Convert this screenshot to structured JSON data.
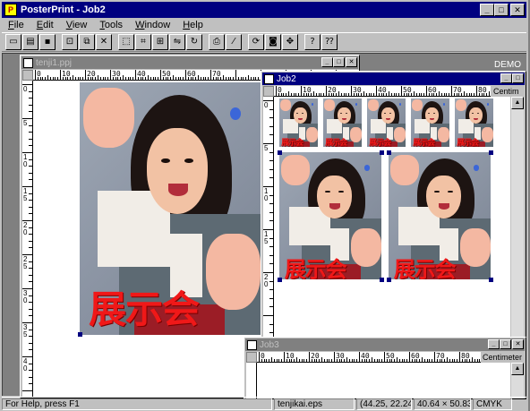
{
  "app": {
    "title": "PosterPrint - Job2",
    "icon_label": "P"
  },
  "menu": [
    "File",
    "Edit",
    "View",
    "Tools",
    "Window",
    "Help"
  ],
  "toolbar": {
    "buttons": [
      {
        "name": "new-icon",
        "glyph": "▭"
      },
      {
        "name": "open-icon",
        "glyph": "▤"
      },
      {
        "name": "save-icon",
        "glyph": "▪"
      },
      {
        "name": "import-icon",
        "glyph": "⊡"
      },
      {
        "name": "duplicate-icon",
        "glyph": "⧉"
      },
      {
        "name": "delete-icon",
        "glyph": "✕"
      },
      {
        "name": "select-frame-icon",
        "glyph": "⬚"
      },
      {
        "name": "crop-icon",
        "glyph": "⌗"
      },
      {
        "name": "fit-icon",
        "glyph": "⊞"
      },
      {
        "name": "flip-icon",
        "glyph": "⇋"
      },
      {
        "name": "rotate-icon",
        "glyph": "↻"
      },
      {
        "name": "print-icon",
        "glyph": "⎙"
      },
      {
        "name": "wand-icon",
        "glyph": "⁄"
      },
      {
        "name": "refresh-icon",
        "glyph": "⟳"
      },
      {
        "name": "camera-icon",
        "glyph": "◙"
      },
      {
        "name": "move-icon",
        "glyph": "✥"
      },
      {
        "name": "help-icon",
        "glyph": "?"
      },
      {
        "name": "context-help-icon",
        "glyph": "⁇"
      }
    ]
  },
  "workspace": {
    "demo_label": "DEMO"
  },
  "windows": {
    "tenji": {
      "title": "tenji1.ppj",
      "ruler_labels": [
        "0",
        "10",
        "20",
        "30",
        "40",
        "50",
        "60",
        "70"
      ],
      "vruler_labels": [
        "0",
        "5",
        "1 0",
        "1 5",
        "2 0",
        "2 5",
        "3 0",
        "3 5",
        "4 0"
      ]
    },
    "job2": {
      "title": "Job2",
      "unit": "Centim",
      "ruler_labels": [
        "0",
        "10",
        "20",
        "30",
        "40",
        "50",
        "60",
        "70",
        "80"
      ],
      "vruler_labels": [
        "0",
        "5",
        "1 0",
        "1 5",
        "2 0"
      ]
    },
    "job3": {
      "title": "Job3",
      "unit": "Centimeter",
      "ruler_labels": [
        "0",
        "10",
        "20",
        "30",
        "40",
        "50",
        "60",
        "70",
        "80"
      ]
    }
  },
  "poster": {
    "caption": "展示会"
  },
  "status": {
    "help": "For Help, press F1",
    "file": "tenjikai.eps",
    "coords": "(44.25, 22.24)",
    "size": "40.64 × 50.83",
    "color_mode": "CMYK"
  },
  "colors": {
    "titlebar_active": "#000080",
    "desktop": "#008080",
    "chrome": "#c0c0c0",
    "caption_red": "#f01818"
  }
}
